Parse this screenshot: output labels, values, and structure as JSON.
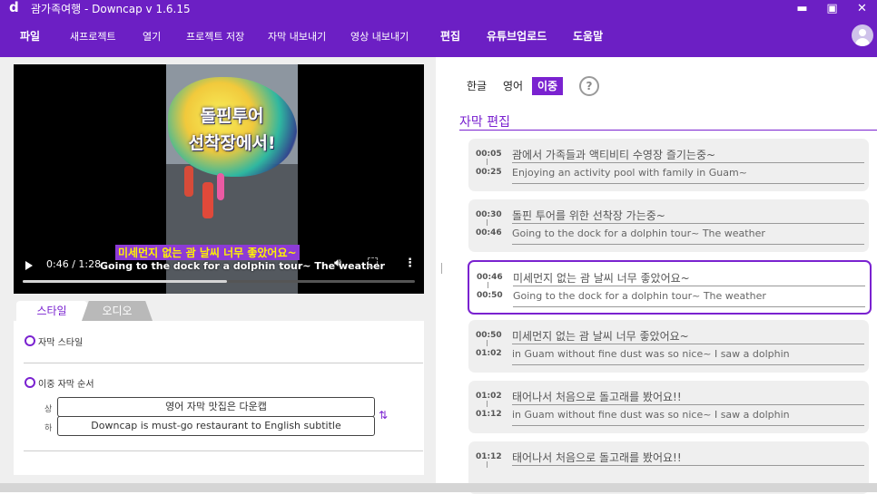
{
  "window": {
    "title": "괌가족여행 - Downcap v 1.6.15",
    "logo": "d",
    "minimize": "▬",
    "maximize": "▣",
    "close": "✕"
  },
  "menu": {
    "file": "파일",
    "new_project": "새프로젝트",
    "open": "열기",
    "save_project": "프로젝트 저장",
    "export_subtitle": "자막 내보내기",
    "export_video": "영상 내보내기",
    "edit": "편집",
    "youtube_upload": "유튜브업로드",
    "help": "도움말"
  },
  "video": {
    "overlay_line1": "돌핀투어",
    "overlay_line2": "선착장에서!",
    "subtitle_ko": "미세먼지 없는 괌 날씨 너무 좋았어요~",
    "subtitle_en": "Going to the dock for a dolphin tour~ The weather",
    "time": "0:46 / 1:28",
    "progress": 0.52
  },
  "tabs": {
    "style": "스타일",
    "audio": "오디오"
  },
  "settings": {
    "subtitle_style": "자막 스타일",
    "dual_order": "이중 자막 순서",
    "upper_label": "상",
    "lower_label": "하",
    "upper_value": "영어 자막 맛집은 다운캡",
    "lower_value": "Downcap is must-go restaurant to English subtitle",
    "swap_icon": "⇅"
  },
  "lang_tabs": {
    "korean": "한글",
    "english": "영어",
    "dual": "이중",
    "help": "?"
  },
  "section_title": "자막 편집",
  "cards": [
    {
      "start": "00:05",
      "end": "00:25",
      "ko": "괌에서 가족들과 액티비티 수영장 즐기는중~",
      "en": "Enjoying an activity pool with family in Guam~"
    },
    {
      "start": "00:30",
      "end": "00:46",
      "ko": "돌핀 투어를 위한 선착장 가는중~",
      "en": "Going to the dock for a dolphin tour~ The weather"
    },
    {
      "start": "00:46",
      "end": "00:50",
      "ko": "미세먼지 없는 괌 날씨 너무 좋았어요~",
      "en": "Going to the dock for a dolphin tour~ The weather"
    },
    {
      "start": "00:50",
      "end": "01:02",
      "ko": "미세먼지 없는 괌 날씨 너무 좋았어요~",
      "en": "in Guam without fine dust was so nice~ I saw a dolphin"
    },
    {
      "start": "01:02",
      "end": "01:12",
      "ko": "태어나서 처음으로 돌고래를 봤어요!!",
      "en": "in Guam without fine dust was so nice~ I saw a dolphin"
    },
    {
      "start": "01:12",
      "end": "",
      "ko": "태어나서 처음으로 돌고래를 봤어요!!",
      "en": ""
    }
  ],
  "colors": {
    "accent": "#7a22d0",
    "titlebar": "#6c1fc4"
  }
}
